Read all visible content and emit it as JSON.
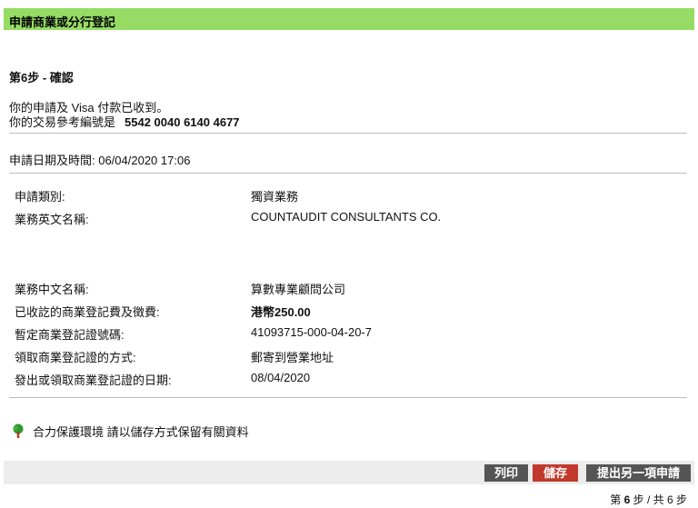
{
  "header": {
    "title": "申請商業或分行登記"
  },
  "step": {
    "title": "第6步 - 確認"
  },
  "receipt": {
    "line1": "你的申請及 Visa 付款已收到。",
    "ref_label": "你的交易參考編號是",
    "ref_number": "5542 0040 6140 4677"
  },
  "application_datetime": "申請日期及時間: 06/04/2020 17:06",
  "details": [
    {
      "label": "申請類別:",
      "value": "獨資業務"
    },
    {
      "label": "業務英文名稱:",
      "value": "COUNTAUDIT CONSULTANTS CO."
    },
    {
      "label": "業務中文名稱:",
      "value": "算數專業顧問公司"
    },
    {
      "label": "已收訖的商業登記費及徵費:",
      "value": "港幣250.00"
    },
    {
      "label": "暫定商業登記證號碼:",
      "value": "41093715-000-04-20-7"
    },
    {
      "label": "領取商業登記證的方式:",
      "value": "郵寄到營業地址"
    },
    {
      "label": "發出或領取商業登記證的日期:",
      "value": "08/04/2020"
    }
  ],
  "environment_note": "合力保護環境 請以儲存方式保留有關資料",
  "buttons": {
    "print": "列印",
    "save": "儲存",
    "another": "提出另一項申請"
  },
  "footer": {
    "step_prefix": "第",
    "step_current": "6",
    "step_mid": "步 / 共 6 步"
  },
  "icons": {
    "environment": "tree-icon"
  },
  "colors": {
    "header_bg": "#96dc64",
    "save_btn": "#c0392b",
    "btn": "#555555"
  }
}
